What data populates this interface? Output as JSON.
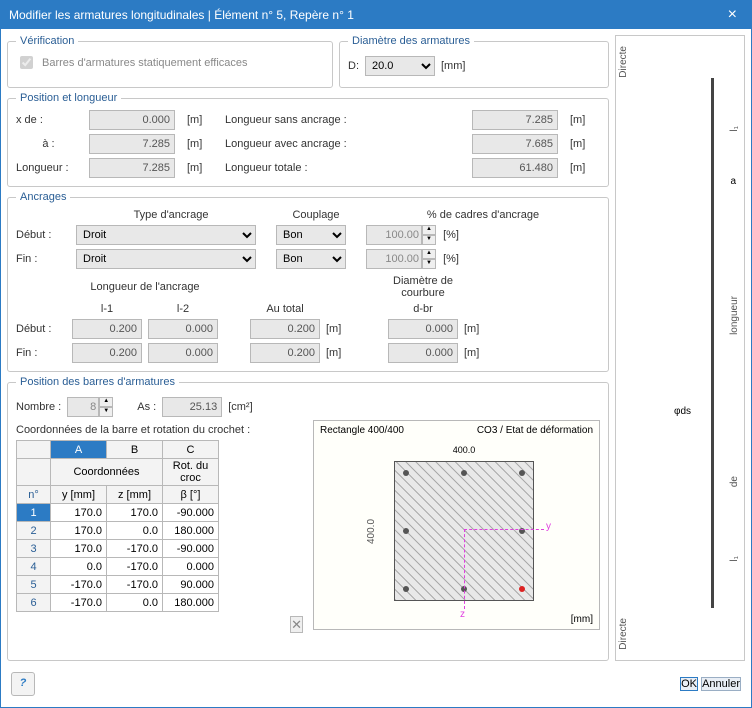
{
  "title": "Modifier les armatures longitudinales | Élément n° 5, Repère n° 1",
  "verif": {
    "legend": "Vérification",
    "cb": "Barres d'armatures statiquement efficaces"
  },
  "diam": {
    "legend": "Diamètre des armatures",
    "label": "D:",
    "value": "20.0",
    "unit": "[mm]"
  },
  "pos": {
    "legend": "Position et longueur",
    "xde": "x de :",
    "xde_v": "0.000",
    "a": "à :",
    "a_v": "7.285",
    "long": "Longueur :",
    "long_v": "7.285",
    "lsa": "Longueur sans ancrage :",
    "lsa_v": "7.285",
    "laa": "Longueur avec ancrage :",
    "laa_v": "7.685",
    "lt": "Longueur totale :",
    "lt_v": "61.480",
    "unit": "[m]"
  },
  "anc": {
    "legend": "Ancrages",
    "type": "Type d'ancrage",
    "coup": "Couplage",
    "pct": "% de cadres d'ancrage",
    "debut": "Début :",
    "fin": "Fin :",
    "droit": "Droit",
    "bon": "Bon",
    "pct_v1": "100.00",
    "pct_v2": "100.00",
    "pctu": "[%]",
    "lh": "Longueur de l'ancrage",
    "l1": "l-1",
    "l2": "l-2",
    "tot": "Au total",
    "dbr": "Diamètre de courbure",
    "dbr2": "d-br",
    "d_l1": "0.200",
    "d_l2": "0.000",
    "d_tot": "0.200",
    "d_dbr": "0.000",
    "f_l1": "0.200",
    "f_l2": "0.000",
    "f_tot": "0.200",
    "f_dbr": "0.000",
    "m": "[m]"
  },
  "bars": {
    "legend": "Position des barres d'armatures",
    "nbr": "Nombre :",
    "nbr_v": "8",
    "as": "As :",
    "as_v": "25.13",
    "asu": "[cm²]",
    "coord_hdr": "Coordonnées de la barre et rotation du crochet :",
    "cols": {
      "A": "A",
      "B": "B",
      "C": "C",
      "coord": "Coordonnées",
      "rot": "Rot. du croc",
      "n": "n°",
      "y": "y [mm]",
      "z": "z [mm]",
      "b": "β [°]"
    },
    "rows": [
      {
        "n": "1",
        "y": "170.0",
        "z": "170.0",
        "b": "-90.000"
      },
      {
        "n": "2",
        "y": "170.0",
        "z": "0.0",
        "b": "180.000"
      },
      {
        "n": "3",
        "y": "170.0",
        "z": "-170.0",
        "b": "-90.000"
      },
      {
        "n": "4",
        "y": "0.0",
        "z": "-170.0",
        "b": "0.000"
      },
      {
        "n": "5",
        "y": "-170.0",
        "z": "-170.0",
        "b": "90.000"
      },
      {
        "n": "6",
        "y": "-170.0",
        "z": "0.0",
        "b": "180.000"
      }
    ]
  },
  "preview": {
    "title": "Rectangle 400/400",
    "state": "CO3 / Etat de déformation",
    "w": "400.0",
    "h": "400.0",
    "unit": "[mm]",
    "y": "y",
    "z": "z"
  },
  "side": {
    "d1": "Directe",
    "d2": "Directe",
    "longueur": "longueur",
    "de": "de",
    "a": "a",
    "phi": "φds",
    "l1": "l₁"
  },
  "footer": {
    "ok": "OK",
    "cancel": "Annuler"
  }
}
